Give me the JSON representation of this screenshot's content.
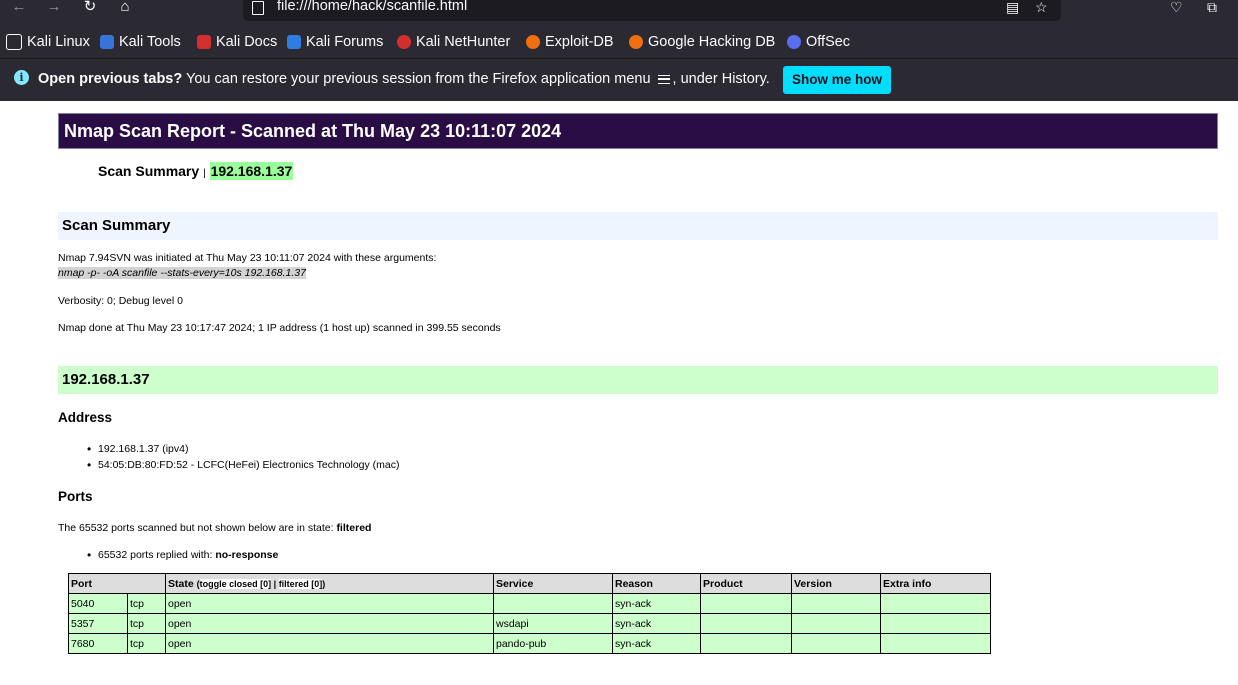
{
  "browser": {
    "url": "file:///home/hack/scanfile.html",
    "bookmarks": [
      {
        "label": "Kali Linux",
        "icon": "kali-dragon-icon",
        "color": "#2b2a33"
      },
      {
        "label": "Kali Tools",
        "icon": "kali-tools-icon",
        "color": "#3873d9"
      },
      {
        "label": "Kali Docs",
        "icon": "kali-docs-icon",
        "color": "#d32f2f"
      },
      {
        "label": "Kali Forums",
        "icon": "kali-forums-icon",
        "color": "#2f7de1"
      },
      {
        "label": "Kali NetHunter",
        "icon": "kali-nethunter-icon",
        "color": "#d32f2f"
      },
      {
        "label": "Exploit-DB",
        "icon": "exploit-db-icon",
        "color": "#f0700f"
      },
      {
        "label": "Google Hacking DB",
        "icon": "ghdb-icon",
        "color": "#f0700f"
      },
      {
        "label": "OffSec",
        "icon": "offsec-icon",
        "color": "#5a6ef0"
      }
    ],
    "notice": {
      "bold": "Open previous tabs?",
      "text_before_icon": " You can restore your previous session from the Firefox application menu ",
      "text_after_icon": ", under History.",
      "button": "Show me how"
    }
  },
  "report": {
    "title": "Nmap Scan Report - Scanned at Thu May 23 10:11:07 2024",
    "summary_label": "Scan Summary",
    "summary_sep": "|",
    "summary_ip": "192.168.1.37",
    "scan_summary_heading": "Scan Summary",
    "initiated": "Nmap 7.94SVN was initiated at Thu May 23 10:11:07 2024 with these arguments:",
    "arguments": "nmap -p- -oA scanfile --stats-every=10s 192.168.1.37",
    "verbosity": "Verbosity: 0; Debug level 0",
    "done": "Nmap done at Thu May 23 10:17:47 2024; 1 IP address (1 host up) scanned in 399.55 seconds",
    "host_heading": "192.168.1.37",
    "address_heading": "Address",
    "addresses": [
      "192.168.1.37 (ipv4)",
      "54:05:DB:80:FD:52 - LCFC(HeFei) Electronics Technology (mac)"
    ],
    "ports_heading": "Ports",
    "filtered_text": "The 65532 ports scanned but not shown below are in state:",
    "filtered_state": "filtered",
    "replied_text": "65532 ports replied with:",
    "replied_reason": "no-response",
    "table": {
      "headers": {
        "port": "Port",
        "state": "State",
        "toggle_open": "(",
        "toggle_closed": "toggle closed [0]",
        "toggle_sep": "|",
        "toggle_filtered": "filtered [0]",
        "toggle_close": ")",
        "service": "Service",
        "reason": "Reason",
        "product": "Product",
        "version": "Version",
        "extra": "Extra info"
      },
      "rows": [
        {
          "port": "5040",
          "proto": "tcp",
          "state": "open",
          "service": "",
          "reason": "syn-ack",
          "product": "",
          "version": "",
          "extra": ""
        },
        {
          "port": "5357",
          "proto": "tcp",
          "state": "open",
          "service": "wsdapi",
          "reason": "syn-ack",
          "product": "",
          "version": "",
          "extra": ""
        },
        {
          "port": "7680",
          "proto": "tcp",
          "state": "open",
          "service": "pando-pub",
          "reason": "syn-ack",
          "product": "",
          "version": "",
          "extra": ""
        }
      ]
    }
  }
}
